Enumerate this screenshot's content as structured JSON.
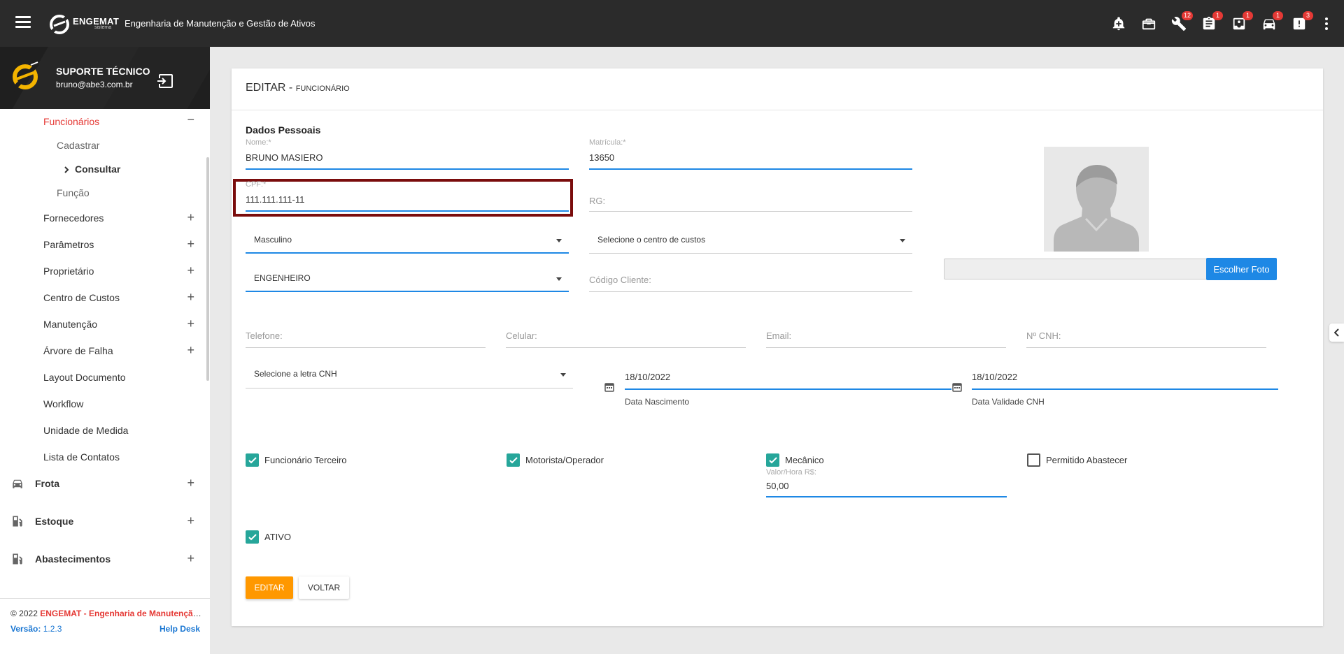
{
  "header": {
    "brand": "ENGEMAT",
    "brand_sub": "sistema",
    "title": "Engenharia de Manutenção e Gestão de Ativos",
    "icons": [
      {
        "name": "alert-bell-icon",
        "badge": ""
      },
      {
        "name": "toolbox-icon",
        "badge": ""
      },
      {
        "name": "wrench-icon",
        "badge": "12"
      },
      {
        "name": "clipboard-icon",
        "badge": "1"
      },
      {
        "name": "inbox-icon",
        "badge": "1"
      },
      {
        "name": "car-icon",
        "badge": "1"
      },
      {
        "name": "warning-doc-icon",
        "badge": "3"
      }
    ]
  },
  "profile": {
    "name": "SUPORTE TÉCNICO",
    "email": "bruno@abe3.com.br"
  },
  "sidebar": {
    "items": [
      {
        "label": "Funcionários",
        "toggle": "−"
      },
      {
        "label": "Cadastrar"
      },
      {
        "label": "Consultar"
      },
      {
        "label": "Função"
      },
      {
        "label": "Fornecedores",
        "toggle": "+"
      },
      {
        "label": "Parâmetros",
        "toggle": "+"
      },
      {
        "label": "Proprietário",
        "toggle": "+"
      },
      {
        "label": "Centro de Custos",
        "toggle": "+"
      },
      {
        "label": "Manutenção",
        "toggle": "+"
      },
      {
        "label": "Árvore de Falha",
        "toggle": "+"
      },
      {
        "label": "Layout Documento"
      },
      {
        "label": "Workflow"
      },
      {
        "label": "Unidade de Medida"
      },
      {
        "label": "Lista de Contatos"
      },
      {
        "label": "Frota",
        "toggle": "+"
      },
      {
        "label": "Estoque",
        "toggle": "+"
      },
      {
        "label": "Abastecimentos",
        "toggle": "+"
      }
    ]
  },
  "footer": {
    "copy_prefix": "© 2022 ",
    "copy_brand": "ENGEMAT - Engenharia de Manutenção e Gestão de Ativos",
    "version_label": "Versão:",
    "version": "1.2.3",
    "help": "Help Desk"
  },
  "page": {
    "title": "EDITAR - ",
    "subtitle": "FUNCIONÁRIO",
    "section": "Dados Pessoais"
  },
  "form": {
    "nome_label": "Nome:*",
    "nome": "BRUNO MASIERO",
    "matricula_label": "Matrícula:*",
    "matricula": "13650",
    "cpf_label": "CPF:*",
    "cpf": "111.111.111-11",
    "rg_placeholder": "RG:",
    "sexo": "Masculino",
    "centro_custos": "Selecione o centro de custos",
    "funcao": "ENGENHEIRO",
    "codigo_placeholder": "Código Cliente:",
    "telefone_placeholder": "Telefone:",
    "celular_placeholder": "Celular:",
    "email_placeholder": "Email:",
    "cnh_placeholder": "Nº CNH:",
    "letra_cnh": "Selecione a letra CNH",
    "data_nascimento": "18/10/2022",
    "data_nascimento_label": "Data Nascimento",
    "data_validade": "18/10/2022",
    "data_validade_label": "Data Validade CNH",
    "foto_button": "Escolher Foto",
    "chk_terceiro": "Funcionário Terceiro",
    "chk_motorista": "Motorista/Operador",
    "chk_mecanico": "Mecânico",
    "chk_abastecer": "Permitido Abastecer",
    "valor_hora_label": "Valor/Hora R$:",
    "valor_hora": "50,00",
    "chk_ativo": "ATIVO",
    "btn_editar": "EDITAR",
    "btn_voltar": "VOLTAR"
  },
  "colors": {
    "accent": "#1e88e5",
    "brand_red": "#e53935",
    "orange": "#ff9800",
    "check": "#26a69a"
  }
}
